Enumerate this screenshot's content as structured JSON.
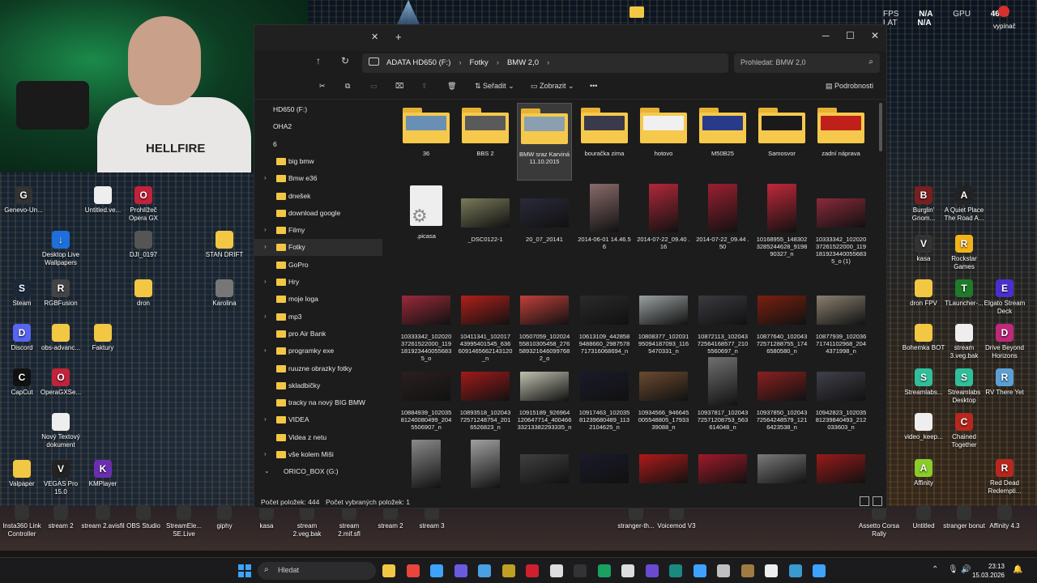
{
  "overlay": {
    "fps_label": "FPS",
    "fps_value": "N/A",
    "gpu_label": "GPU",
    "gpu_value": "46°C",
    "lat_label": "LAT",
    "lat_value": "N/A",
    "power_label": "vypínač"
  },
  "webcam": {
    "shirt_text": "HELLFIRE"
  },
  "desktop_left": [
    {
      "label": "Genevo-Un...",
      "icon": "G",
      "color": "#333333"
    },
    {
      "label": "Untitled.ve...",
      "icon": "",
      "color": "#eeeeee"
    },
    {
      "label": "Prohlížeč Opera GX",
      "icon": "O",
      "color": "#c2223a"
    },
    {
      "label": "Desktop Live Wallpapers",
      "icon": "↓",
      "color": "#1e6fd9"
    },
    {
      "label": "DJI_0197",
      "icon": "",
      "color": "#555555"
    },
    {
      "label": "STAN DRIFT",
      "icon": "",
      "color": "#f2c744"
    },
    {
      "label": "Steam",
      "icon": "S",
      "color": "#1b2838"
    },
    {
      "label": "RGBFusion",
      "icon": "R",
      "color": "#444444"
    },
    {
      "label": "dron",
      "icon": "",
      "color": "#f2c744"
    },
    {
      "label": "Karolina",
      "icon": "",
      "color": "#777777"
    },
    {
      "label": "Discord",
      "icon": "D",
      "color": "#5865f2"
    },
    {
      "label": "obs-advanc...",
      "icon": "",
      "color": "#f2c744"
    },
    {
      "label": "Faktury",
      "icon": "",
      "color": "#f2c744"
    },
    {
      "label": "CapCut",
      "icon": "C",
      "color": "#111111"
    },
    {
      "label": "OperaGXSe...",
      "icon": "O",
      "color": "#c2223a"
    },
    {
      "label": "Nový Textový dokument",
      "icon": "",
      "color": "#eeeeee"
    },
    {
      "label": "Valpaper",
      "icon": "",
      "color": "#f2c744"
    },
    {
      "label": "VEGAS Pro 15.0",
      "icon": "V",
      "color": "#222222"
    },
    {
      "label": "KMPlayer",
      "icon": "K",
      "color": "#6a2fb0"
    }
  ],
  "desktop_bottom": [
    {
      "label": "Insta360 Link Controller"
    },
    {
      "label": "stream 2"
    },
    {
      "label": "stream 2.avisfil"
    },
    {
      "label": "OBS Studio"
    },
    {
      "label": "StreamEle... SE.Live"
    },
    {
      "label": "giphy"
    },
    {
      "label": "kasa"
    },
    {
      "label": "stream 2.veg.bak"
    },
    {
      "label": "stream 2.mif.sfl"
    },
    {
      "label": "stream 2"
    },
    {
      "label": "stream 3"
    },
    {
      "label": "stranger-th..."
    },
    {
      "label": "Voicemod V3"
    },
    {
      "label": "Assetto Corsa Rally"
    },
    {
      "label": "Untitled"
    },
    {
      "label": "stranger bonut"
    },
    {
      "label": "Affinity 4.3"
    }
  ],
  "desktop_right": [
    {
      "label": "Burglin' Gnom...",
      "icon": "B",
      "color": "#7a1f1f"
    },
    {
      "label": "A Quiet Place The Road A...",
      "icon": "A",
      "color": "#222222"
    },
    {
      "label": "kasa",
      "icon": "V",
      "color": "#333333"
    },
    {
      "label": "Rockstar Games",
      "icon": "R",
      "color": "#f2b31a"
    },
    {
      "label": "dron FPV",
      "icon": "",
      "color": "#f2c744"
    },
    {
      "label": "TLauncher-...",
      "icon": "T",
      "color": "#1f7a2a"
    },
    {
      "label": "Elgato Stream Deck",
      "icon": "E",
      "color": "#4a2fd0"
    },
    {
      "label": "Bohemka BOT",
      "icon": "",
      "color": "#f2c744"
    },
    {
      "label": "stream 3.veg.bak",
      "icon": "",
      "color": "#eeeeee"
    },
    {
      "label": "Drive Beyond Horizons",
      "icon": "D",
      "color": "#c0287a"
    },
    {
      "label": "Streamlabs...",
      "icon": "S",
      "color": "#2fbf9a"
    },
    {
      "label": "Streamlabs Desktop",
      "icon": "S",
      "color": "#2fbf9a"
    },
    {
      "label": "RV There Yet",
      "icon": "R",
      "color": "#5aa0d6"
    },
    {
      "label": "video_keep...",
      "icon": "",
      "color": "#eeeeee"
    },
    {
      "label": "Chained Together",
      "icon": "C",
      "color": "#b8271f"
    },
    {
      "label": "Affinity",
      "icon": "A",
      "color": "#8acd2a"
    },
    {
      "label": "Red Dead Redempti...",
      "icon": "R",
      "color": "#b8271f"
    }
  ],
  "explorer": {
    "tab_close": "✕",
    "tab_new": "+",
    "minimize": "─",
    "maximize": "☐",
    "close": "✕",
    "breadcrumbs": [
      "ADATA HD650 (F:)",
      "Fotky",
      "BMW 2,0"
    ],
    "search_placeholder": "Prohledat: BMW 2,0",
    "toolbar": {
      "sort": "Seřadit",
      "view": "Zobrazit",
      "more": "•••",
      "details": "Podrobnosti"
    },
    "sidebar": [
      {
        "label": "HD650 (F:)",
        "kind": "drive",
        "chevron": ""
      },
      {
        "label": "OHA2",
        "kind": "drive",
        "chevron": ""
      },
      {
        "label": "6",
        "kind": "drive",
        "chevron": ""
      },
      {
        "label": "big bmw",
        "kind": "folder",
        "chevron": ""
      },
      {
        "label": "Bmw e36",
        "kind": "folder",
        "chevron": "›"
      },
      {
        "label": "dnešek",
        "kind": "folder",
        "chevron": ""
      },
      {
        "label": "download google",
        "kind": "folder",
        "chevron": ""
      },
      {
        "label": "Filmy",
        "kind": "folder",
        "chevron": "›"
      },
      {
        "label": "Fotky",
        "kind": "folder",
        "chevron": "›"
      },
      {
        "label": "GoPro",
        "kind": "folder",
        "chevron": ""
      },
      {
        "label": "Hry",
        "kind": "folder",
        "chevron": "›"
      },
      {
        "label": "moje loga",
        "kind": "folder",
        "chevron": ""
      },
      {
        "label": "mp3",
        "kind": "folder",
        "chevron": "›"
      },
      {
        "label": "pro Air Bank",
        "kind": "folder",
        "chevron": ""
      },
      {
        "label": "programky exe",
        "kind": "folder",
        "chevron": "›"
      },
      {
        "label": "ruuzne obrazky fotky",
        "kind": "folder",
        "chevron": ""
      },
      {
        "label": "skladbičky",
        "kind": "folder",
        "chevron": ""
      },
      {
        "label": "tracky na nový BIG BMW",
        "kind": "folder",
        "chevron": ""
      },
      {
        "label": "VIDEA",
        "kind": "folder",
        "chevron": "›"
      },
      {
        "label": "Videa z netu",
        "kind": "folder",
        "chevron": ""
      },
      {
        "label": "vše kolem Miši",
        "kind": "folder",
        "chevron": "›"
      },
      {
        "label": "ORICO_BOX (G:)",
        "kind": "drive",
        "chevron": "⌄"
      }
    ],
    "folders": [
      {
        "label": "36",
        "preview": "#6a8fb5"
      },
      {
        "label": "BBS 2",
        "preview": "#5a5a5a"
      },
      {
        "label": "BMW sraz Karviná 11.10.2015",
        "preview": "#8aa0b0"
      },
      {
        "label": "bouračka zima",
        "preview": "#3a3a4a"
      },
      {
        "label": "hotovo",
        "preview": "#f0f0f0"
      },
      {
        "label": "M50B25",
        "preview": "#2a3a8a"
      },
      {
        "label": "Samosvor",
        "preview": "#1a1a1a"
      },
      {
        "label": "zadní náprava",
        "preview": "#c0201a"
      }
    ],
    "files_row1": [
      {
        "label": ".picasa",
        "kind": "picasa",
        "color": ""
      },
      {
        "label": "_DSC0122-1",
        "kind": "photo",
        "color": "#7a7a5a"
      },
      {
        "label": "20_07_20141",
        "kind": "photo",
        "color": "#2a2a3a"
      },
      {
        "label": "2014-06-01 14.46.56",
        "kind": "tall",
        "color": "#8a6a6a"
      },
      {
        "label": "2014-07-22_09.40 .16",
        "kind": "tall",
        "color": "#b0283a"
      },
      {
        "label": "2014-07-22_09.44 .50",
        "kind": "tall",
        "color": "#9a2030"
      },
      {
        "label": "10168955_148302 3285244628_9198 90327_n",
        "kind": "tall",
        "color": "#c0283a"
      },
      {
        "label": "10333342_102020 37261522000_119 181923440055683 5_o (1)",
        "kind": "photo",
        "color": "#8a2a3a"
      }
    ],
    "files_row2": [
      {
        "label": "10333342_102020 37261522000_119 181923440055683 5_o",
        "color": "#9a2a3a"
      },
      {
        "label": "10411341_102017 43995401545_636 6091465662143120_n",
        "color": "#b0201a"
      },
      {
        "label": "10507059_102024 55810305458_276 589321646099768 2_o",
        "color": "#c0403a"
      },
      {
        "label": "10613109_442858 9488660_2987578 717316068694_n",
        "color": "#2a2a2a"
      },
      {
        "label": "10808377_102031 95094187093_116 5470331_n",
        "color": "#9aa0a0"
      },
      {
        "label": "10872113_102043 72564168577_210 5560697_n",
        "color": "#3a3a40"
      },
      {
        "label": "10877640_102043 72571288755_174 6580580_n",
        "color": "#7a2010"
      },
      {
        "label": "10877939_102036 71741102968_204 4371998_n",
        "color": "#8a8070"
      }
    ],
    "files_row3": [
      {
        "label": "10884939_102035 81240080499_204 5506907_n",
        "color": "#2a2020",
        "tall": false
      },
      {
        "label": "10893518_102043 72571248754_201 6526823_n",
        "color": "#a01a1a",
        "tall": false
      },
      {
        "label": "10915189_926964 120647714_400466 33213382293335_n",
        "color": "#c0c0b0",
        "tall": false
      },
      {
        "label": "10917463_102035 81239680489_113 2104625_n",
        "color": "#1a1a2a",
        "tall": false
      },
      {
        "label": "10934566_946645 005548805_17933 39088_n",
        "color": "#6a4a30",
        "tall": false
      },
      {
        "label": "10937817_102043 72571208753_563 614048_n",
        "color": "#707070",
        "tall": true
      },
      {
        "label": "10937850_102043 72564248579_121 6423538_n",
        "color": "#8a2020",
        "tall": false
      },
      {
        "label": "10942823_102035 81239840493_212 033603_n",
        "color": "#40404a",
        "tall": false
      }
    ],
    "files_row4": [
      {
        "color": "#8a8a8a"
      },
      {
        "color": "#a0a0a0"
      },
      {
        "color": "#404040"
      },
      {
        "color": "#1a1a2a"
      },
      {
        "color": "#b01a1a"
      },
      {
        "color": "#a01a2a"
      },
      {
        "color": "#7a7a7a"
      },
      {
        "color": "#9a1a1a"
      }
    ],
    "status": {
      "count": "Počet položek: 444",
      "selected": "Počet vybraných položek: 1"
    }
  },
  "taskbar": {
    "search_label": "Hledat",
    "time": "23:13",
    "date": "15.03.2026",
    "apps": [
      "#f2c744",
      "#e8453c",
      "#3ea3ff",
      "#6a5ae0",
      "#4aa0e0",
      "#c0a020",
      "#d02030",
      "#dddddd",
      "#333333",
      "#1aa060",
      "#dddddd",
      "#6a4ad0",
      "#1a8a80",
      "#3ea3ff",
      "#c0c0c0",
      "#a07a40",
      "#eeeeee",
      "#3a9ad0",
      "#3ea3ff"
    ]
  }
}
